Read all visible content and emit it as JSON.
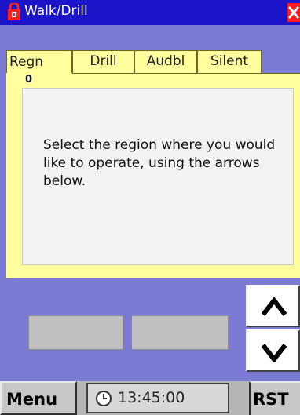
{
  "window": {
    "title": "Walk/Drill",
    "lock_icon": "lock-icon",
    "close_icon": "close-icon"
  },
  "tabs": [
    {
      "label": "Regn",
      "selected": true
    },
    {
      "label": "Drill",
      "selected": false
    },
    {
      "label": "Audbl",
      "selected": false
    },
    {
      "label": "Silent",
      "selected": false
    }
  ],
  "region": {
    "number": "0",
    "message": "Select the region where you would like to operate, using the arrows below."
  },
  "arrows": {
    "up_icon": "caret-up-icon",
    "down_icon": "caret-down-icon"
  },
  "bottom_bar": {
    "menu_label": "Menu",
    "clock_icon": "clock-icon",
    "time": "13:45:00",
    "rst_label": "RST"
  },
  "colors": {
    "titlebar": "#1c14c8",
    "background": "#7b7bd6",
    "panel": "#ffff9e",
    "close": "#ff1a1a"
  }
}
